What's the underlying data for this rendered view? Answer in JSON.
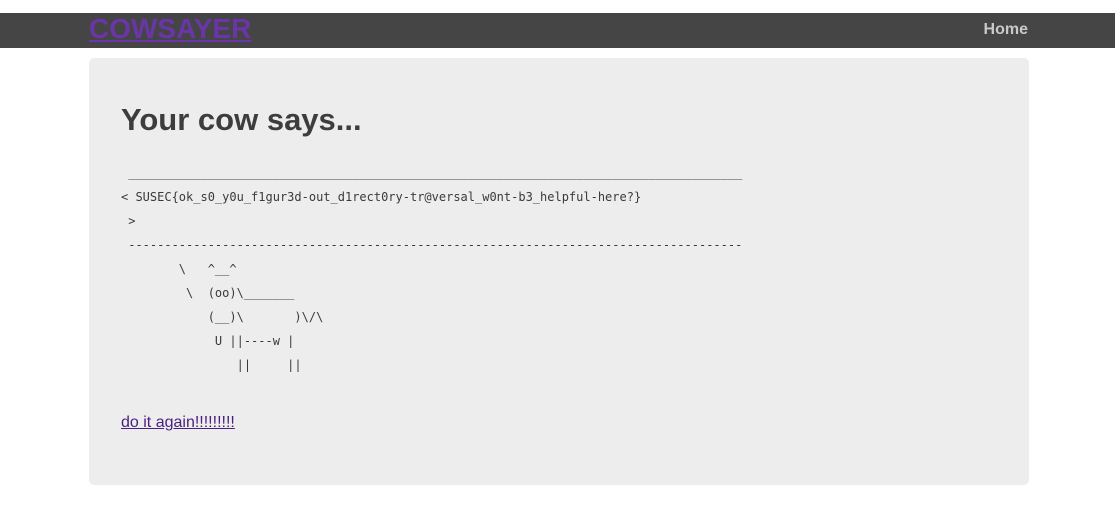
{
  "nav": {
    "brand": "COWSAYER",
    "home": "Home"
  },
  "main": {
    "heading": "Your cow says...",
    "cow_output": " _____________________________________________________________________________________\n< SUSEC{ok_s0_y0u_f1gur3d-out_d1rect0ry-tr@versal_w0nt-b3_helpful-here?}\n >\n -------------------------------------------------------------------------------------\n        \\   ^__^\n         \\  (oo)\\_______\n            (__)\\       )\\/\\\n             U ||----w |\n                ||     ||",
    "again_link": "do it again!!!!!!!!!"
  },
  "colors": {
    "topbar": "#454545",
    "brand": "#6a35a8",
    "panel": "#ededed",
    "link": "#4b2180"
  }
}
